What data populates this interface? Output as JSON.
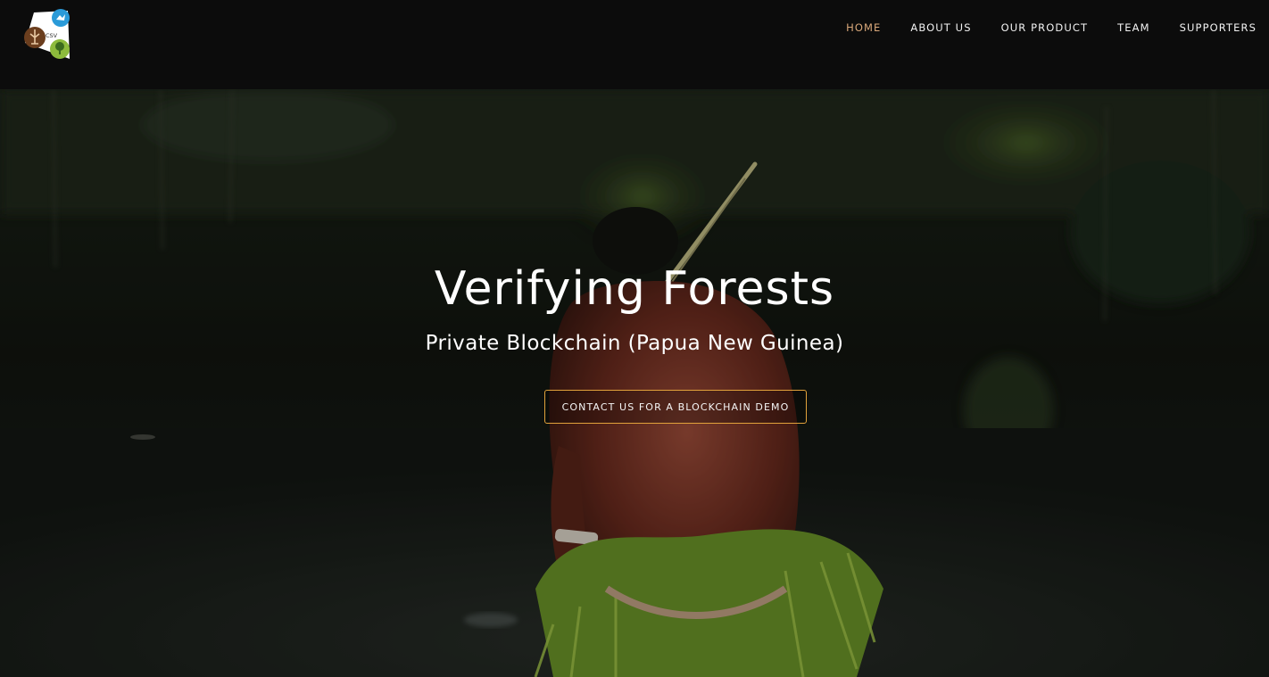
{
  "header": {
    "logo_text": "CSV",
    "nav": [
      {
        "label": "HOME",
        "active": true
      },
      {
        "label": "ABOUT US",
        "active": false
      },
      {
        "label": "OUR PRODUCT",
        "active": false
      },
      {
        "label": "TEAM",
        "active": false
      },
      {
        "label": "SUPPORTERS",
        "active": false
      }
    ]
  },
  "hero": {
    "title": "Verifying Forests",
    "subtitle": "Private Blockchain (Papua New Guinea)",
    "cta_label": "CONTACT US FOR A BLOCKCHAIN DEMO"
  },
  "colors": {
    "header_bg": "#0c0c0c",
    "nav_active": "#d9a87a",
    "nav_text": "#f2f2f2",
    "cta_border": "#e2a23b",
    "logo_blue": "#2a9ad8",
    "logo_brown": "#6b3e1e",
    "logo_green": "#8dbb3c"
  }
}
